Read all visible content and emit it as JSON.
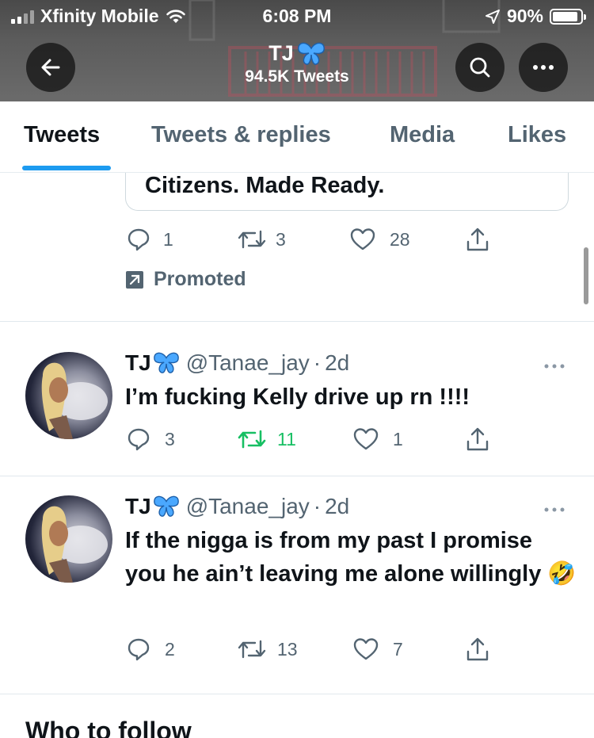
{
  "status_bar": {
    "carrier": "Xfinity Mobile",
    "time": "6:08 PM",
    "battery": "90%",
    "battery_level": 0.9
  },
  "header": {
    "name": "TJ",
    "tweet_count": "94.5K Tweets",
    "back_icon": "arrow-left-icon",
    "search_icon": "search-icon",
    "more_icon": "more-icon"
  },
  "tabs": [
    {
      "label": "Tweets",
      "active": true
    },
    {
      "label": "Tweets & replies",
      "active": false
    },
    {
      "label": "Media",
      "active": false
    },
    {
      "label": "Likes",
      "active": false
    }
  ],
  "promoted_tweet": {
    "card_text": "Citizens. Made Ready.",
    "replies": "1",
    "retweets": "3",
    "likes": "28",
    "promoted_label": "Promoted"
  },
  "tweets": [
    {
      "name": "TJ",
      "handle": "@Tanae_jay",
      "separator": "·",
      "time_ago": "2d",
      "text": "I’m fucking Kelly drive up rn !!!!",
      "replies": "3",
      "retweets": "11",
      "likes": "1",
      "retweeted": true
    },
    {
      "name": "TJ",
      "handle": "@Tanae_jay",
      "separator": "·",
      "time_ago": "2d",
      "text": "If the nigga is from my past I promise you he ain’t leaving me alone willingly 🤣",
      "replies": "2",
      "retweets": "13",
      "likes": "7",
      "retweeted": false
    }
  ],
  "who_to_follow": "Who to follow",
  "colors": {
    "accent": "#1d9bf0",
    "retweet_green": "#17bf63",
    "secondary_text": "#536471",
    "butterfly": "#4aa8ff"
  }
}
